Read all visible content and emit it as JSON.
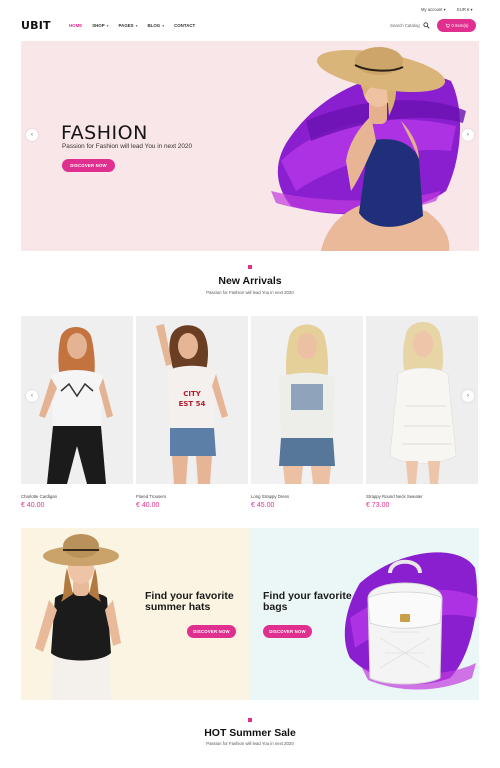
{
  "header": {
    "logo": "UBIT",
    "account": "My account ▾",
    "currency": "EUR € ▾",
    "nav": [
      {
        "label": "Home",
        "caret": ""
      },
      {
        "label": "Shop",
        "caret": "▾"
      },
      {
        "label": "Pages",
        "caret": "▾"
      },
      {
        "label": "Blog",
        "caret": "▾"
      },
      {
        "label": "Contact",
        "caret": ""
      }
    ],
    "search_label": "Search Catalog",
    "cart_label": "0 Item(s)"
  },
  "hero": {
    "title": "FASHION",
    "subtitle": "Passion for Fashion will lead You in next 2020",
    "button": "Discover now",
    "prev_arrow": "‹",
    "next_arrow": "›"
  },
  "new_arrivals": {
    "title": "New Arrivals",
    "subtitle": "Passion for Fashion will lead You in next 2020",
    "prev_arrow": "‹",
    "next_arrow": "›",
    "products": [
      {
        "name": "Charlotte Cardigan",
        "price": "€ 40.00"
      },
      {
        "name": "Flared Trousers",
        "price": "€ 40.00"
      },
      {
        "name": "Long Strappy Dress",
        "price": "€ 45.00"
      },
      {
        "name": "Strappy Round Neck Sweater",
        "price": "€ 73.00"
      }
    ]
  },
  "banners": {
    "left": {
      "title": "Find your favorite summer hats",
      "button": "Discover now"
    },
    "right": {
      "title": "Find your favorite bags",
      "button": "Discover now"
    }
  },
  "hot_sale": {
    "title": "HOT Summer Sale",
    "subtitle": "Passion for Fashion will lead You in next 2020"
  },
  "colors": {
    "accent": "#e0308f",
    "hero_bg": "#f9e6e8",
    "brush_purple": "#8a1fd0"
  }
}
